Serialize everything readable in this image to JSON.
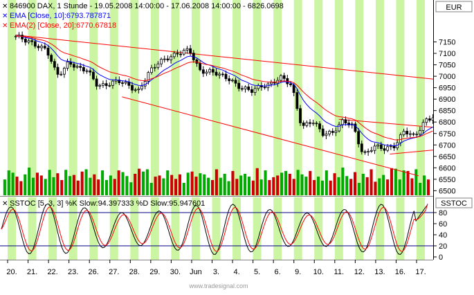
{
  "header": {
    "price_legend": "846900  DAX, 1 Stunde - 19.05.2008 14:00:00 - 17.06.2008 14:00:00 - 6826.0698",
    "ema10_legend": "EMA [Close, 10]:6793.787871",
    "ema20_legend": "EMA(2) [Close, 20]:6770.67818",
    "stoch_legend": "SSTOC [5, 3, 3] %K Slow:94.397333 %D Slow:95.947601"
  },
  "axes": {
    "currency_label": "EUR",
    "stoch_axis_label": "SSTOC",
    "x_labels": [
      "20.",
      "21.",
      "22.",
      "23.",
      "26.",
      "27.",
      "28.",
      "29.",
      "30.",
      "Jun",
      "3.",
      "4.",
      "5.",
      "6.",
      "9.",
      "10.",
      "11.",
      "12.",
      "13.",
      "16.",
      "17."
    ],
    "price_ticks": [
      6500,
      6550,
      6600,
      6650,
      6700,
      6750,
      6800,
      6850,
      6900,
      6950,
      7000,
      7050,
      7100,
      7150
    ],
    "stoch_ticks": [
      0,
      20,
      40,
      60,
      80
    ]
  },
  "watermark": "www.tradesignal.com",
  "colors": {
    "background": "#ffffff",
    "band_green": "#ccf5a3",
    "candle": "#000000",
    "ema10": "#0000ff",
    "ema20": "#ff0000",
    "trendline": "#ff0000",
    "volume_up": "#00aa00",
    "volume_down": "#cc0000",
    "stoch_k": "#000000",
    "stoch_d": "#ff0000",
    "stoch_level": "#000080"
  },
  "chart_data": {
    "type": "candlestick",
    "instrument": "846900 DAX",
    "interval": "1 Stunde",
    "sessions": [
      "20.",
      "21.",
      "22.",
      "23.",
      "26.",
      "27.",
      "28.",
      "29.",
      "30.",
      "2.",
      "3.",
      "4.",
      "5.",
      "6.",
      "9.",
      "10.",
      "11.",
      "12.",
      "13.",
      "16.",
      "17."
    ],
    "price_ylim": [
      6480,
      7200
    ],
    "close_path": [
      [
        0,
        7175
      ],
      [
        0.5,
        7150
      ],
      [
        1,
        7140
      ],
      [
        1.5,
        7120
      ],
      [
        2,
        7000
      ],
      [
        2.3,
        7020
      ],
      [
        2.6,
        7070
      ],
      [
        3,
        7040
      ],
      [
        3.5,
        7020
      ],
      [
        4,
        6960
      ],
      [
        4.5,
        6970
      ],
      [
        5,
        6975
      ],
      [
        5.5,
        6960
      ],
      [
        6,
        6940
      ],
      [
        6.5,
        7010
      ],
      [
        7,
        7060
      ],
      [
        7.5,
        7090
      ],
      [
        8,
        7100
      ],
      [
        8.5,
        7110
      ],
      [
        9,
        7030
      ],
      [
        9.5,
        7020
      ],
      [
        10,
        7000
      ],
      [
        10.5,
        6990
      ],
      [
        11,
        6950
      ],
      [
        11.5,
        6930
      ],
      [
        12,
        6960
      ],
      [
        12.5,
        6970
      ],
      [
        13,
        6990
      ],
      [
        13.5,
        6960
      ],
      [
        14,
        6780
      ],
      [
        14.5,
        6800
      ],
      [
        15,
        6750
      ],
      [
        15.5,
        6760
      ],
      [
        16,
        6800
      ],
      [
        16.5,
        6780
      ],
      [
        17,
        6660
      ],
      [
        17.5,
        6690
      ],
      [
        18,
        6680
      ],
      [
        18.5,
        6700
      ],
      [
        19,
        6760
      ],
      [
        19.5,
        6730
      ],
      [
        20,
        6810
      ],
      [
        20.4,
        6826
      ]
    ],
    "ema10_last": 6793.787871,
    "ema20_last": 6770.67818,
    "trendlines": [
      {
        "from": [
          0,
          7180
        ],
        "to": [
          20.7,
          6985
        ]
      },
      {
        "from": [
          5.2,
          6910
        ],
        "to": [
          19.7,
          6565
        ]
      },
      {
        "from": [
          15.8,
          6812
        ],
        "to": [
          20.7,
          6775
        ]
      },
      {
        "from": [
          18.3,
          6660
        ],
        "to": [
          20.7,
          6680
        ]
      }
    ],
    "volume": [
      28,
      44,
      40,
      33,
      25,
      37,
      49,
      31,
      40,
      35,
      29,
      45,
      32,
      39,
      27,
      45,
      34,
      36,
      26,
      42,
      46,
      31,
      37,
      28,
      44,
      27,
      35,
      29,
      44,
      41,
      34,
      23,
      38,
      47,
      42,
      46,
      22,
      33,
      35,
      30,
      44,
      36,
      29,
      37,
      22,
      40,
      42,
      33,
      39,
      37,
      31,
      27,
      46,
      31,
      38,
      25,
      43,
      29,
      35,
      38,
      33,
      26,
      48,
      28,
      44,
      27,
      32,
      35,
      40,
      43,
      38,
      29,
      45,
      37,
      33,
      43,
      27,
      33,
      26,
      44,
      26,
      39,
      32,
      49,
      34,
      29,
      41,
      22,
      38,
      32,
      46,
      24,
      30,
      36,
      28,
      48,
      47,
      28,
      44,
      43,
      30,
      46,
      22,
      35,
      28
    ],
    "stoch_ylim": [
      -5,
      105
    ],
    "stoch_levels": [
      20,
      80
    ],
    "stoch_k_last": 94.397333,
    "stoch_d_last": 95.947601
  }
}
